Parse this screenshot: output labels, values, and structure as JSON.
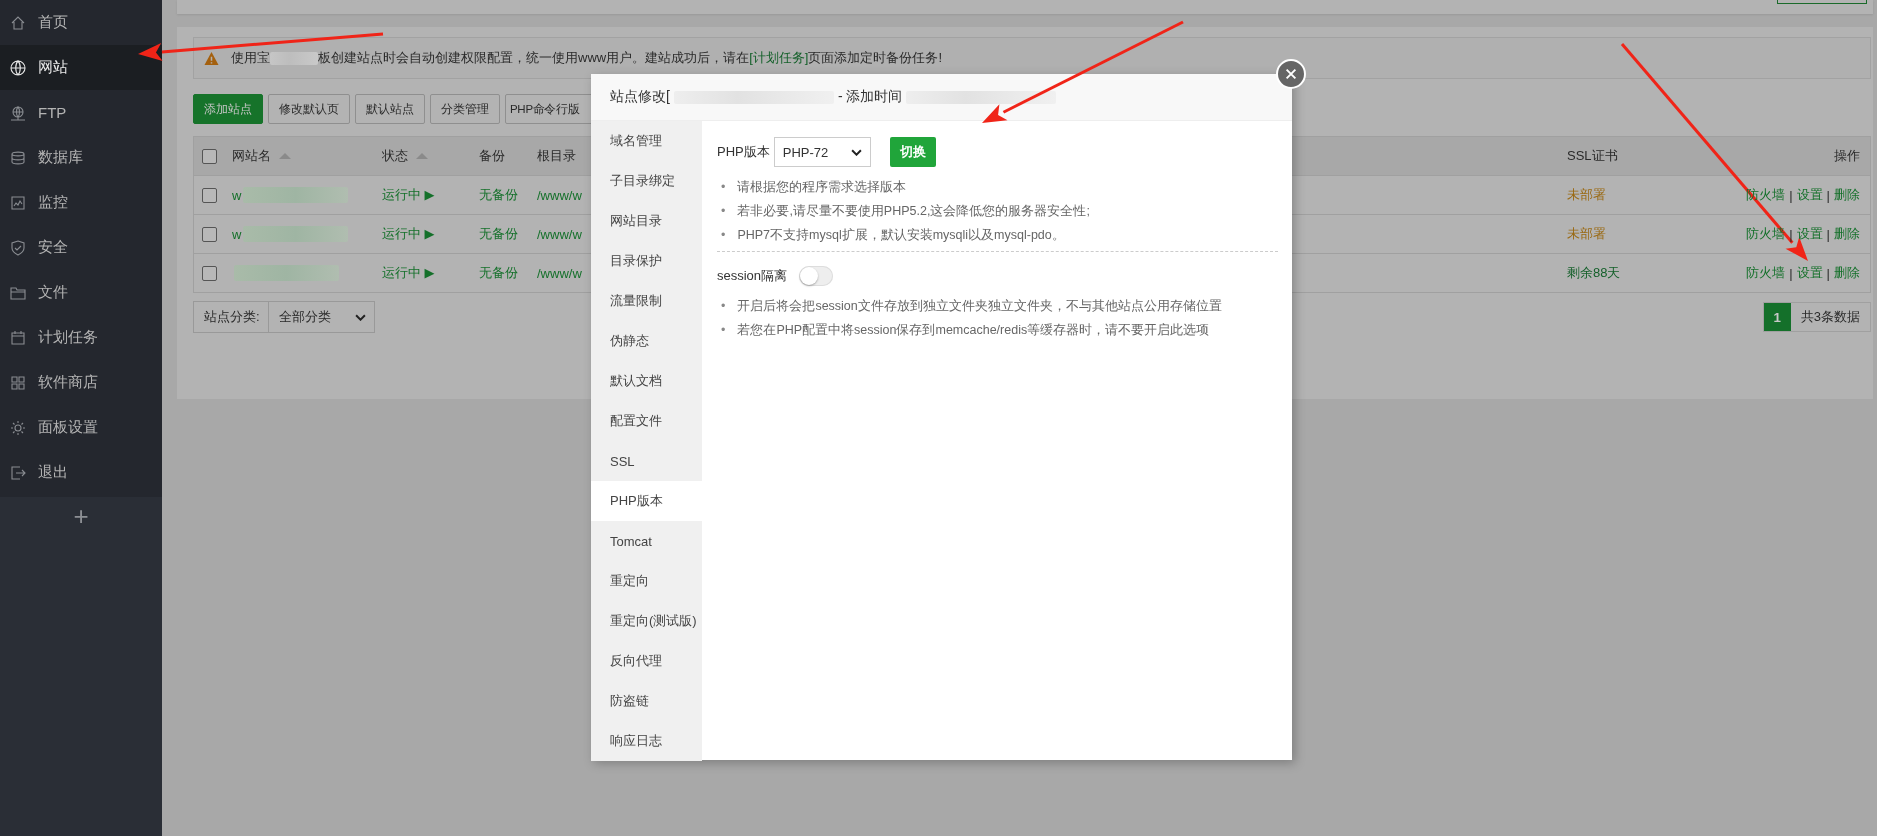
{
  "sidebar": {
    "items": [
      {
        "label": "首页",
        "selected": false
      },
      {
        "label": "网站",
        "selected": true
      },
      {
        "label": "FTP",
        "selected": false
      },
      {
        "label": "数据库",
        "selected": false
      },
      {
        "label": "监控",
        "selected": false
      },
      {
        "label": "安全",
        "selected": false
      },
      {
        "label": "文件",
        "selected": false
      },
      {
        "label": "计划任务",
        "selected": false
      },
      {
        "label": "软件商店",
        "selected": false
      },
      {
        "label": "面板设置",
        "selected": false
      },
      {
        "label": "退出",
        "selected": false
      }
    ],
    "add_button": "+"
  },
  "notice": {
    "head": "使用宝",
    "body": "板创建站点时会自动创建权限配置，统一使用www用户。建站成功后，请在",
    "link": "[计划任务]",
    "tail": "页面添加定时备份任务!"
  },
  "toolbar": {
    "buttons": [
      {
        "label": "添加站点",
        "kind": "primary"
      },
      {
        "label": "修改默认页",
        "kind": "default"
      },
      {
        "label": "默认站点",
        "kind": "default"
      },
      {
        "label": "分类管理",
        "kind": "default"
      },
      {
        "label": "PHP命令行版",
        "kind": "default"
      }
    ]
  },
  "table": {
    "header_checked": false,
    "columns": [
      {
        "label": "网站名",
        "sortable": true
      },
      {
        "label": "状态",
        "sortable": true
      },
      {
        "label": "备份",
        "sortable": false
      },
      {
        "label": "根目录",
        "sortable": false
      },
      {
        "label": "SSL证书",
        "sortable": false
      },
      {
        "label": "操作",
        "sortable": false
      }
    ],
    "rows": [
      {
        "checked": false,
        "name": "w",
        "status": "运行中 ▶",
        "backup": "无备份",
        "root": "/www/w",
        "ssl": "未部署",
        "color": "#9a6a14",
        "actions": [
          {
            "label": "防火墙",
            "kind": "link"
          },
          {
            "label": "|",
            "kind": "separator"
          },
          {
            "label": "设置",
            "kind": "link"
          },
          {
            "label": "|",
            "kind": "separator"
          },
          {
            "label": "删除",
            "kind": "link"
          }
        ]
      },
      {
        "checked": false,
        "name": "w",
        "status": "运行中 ▶",
        "backup": "无备份",
        "root": "/www/w",
        "ssl": "未部署",
        "color": "#9a6a14",
        "actions": [
          {
            "label": "防火墙",
            "kind": "link"
          },
          {
            "label": "|",
            "kind": "separator"
          },
          {
            "label": "设置",
            "kind": "link"
          },
          {
            "label": "|",
            "kind": "separator"
          },
          {
            "label": "删除",
            "kind": "link"
          }
        ]
      },
      {
        "checked": false,
        "status": "运行中 ▶",
        "backup": "无备份",
        "root": "/www/w",
        "ssl": "剩余88天",
        "color": "#14602a",
        "actions": [
          {
            "label": "防火墙",
            "kind": "link"
          },
          {
            "label": "|",
            "kind": "separator"
          },
          {
            "label": "设置",
            "kind": "link"
          },
          {
            "label": "|",
            "kind": "separator"
          },
          {
            "label": "删除",
            "kind": "link"
          }
        ]
      }
    ]
  },
  "footer": {
    "category_label": "站点分类:",
    "category_value": "全部分类",
    "pages": [
      {
        "label": "1",
        "selected": true
      }
    ],
    "total": "共3条数据"
  },
  "dialog": {
    "title": "站点修改[",
    "title_tail": "- 添加时间",
    "tabs": [
      {
        "label": "域名管理",
        "selected": false
      },
      {
        "label": "子目录绑定",
        "selected": false
      },
      {
        "label": "网站目录",
        "selected": false
      },
      {
        "label": "目录保护",
        "selected": false
      },
      {
        "label": "流量限制",
        "selected": false
      },
      {
        "label": "伪静态",
        "selected": false
      },
      {
        "label": "默认文档",
        "selected": false
      },
      {
        "label": "配置文件",
        "selected": false
      },
      {
        "label": "SSL",
        "selected": false
      },
      {
        "label": "PHP版本",
        "selected": true
      },
      {
        "label": "Tomcat",
        "selected": false
      },
      {
        "label": "重定向",
        "selected": false
      },
      {
        "label": "重定向(测试版)",
        "selected": false
      },
      {
        "label": "反向代理",
        "selected": false
      },
      {
        "label": "防盗链",
        "selected": false
      },
      {
        "label": "响应日志",
        "selected": false
      }
    ],
    "php_label": "PHP版本",
    "php_value": "PHP-72",
    "switch_button": "切换",
    "bullet": "•",
    "notes": [
      "请根据您的程序需求选择版本",
      "若非必要,请尽量不要使用PHP5.2,这会降低您的服务器安全性;",
      "PHP7不支持mysql扩展，默认安装mysqli以及mysql-pdo。"
    ],
    "session_label": "session隔离",
    "session_on": false,
    "session_notes": [
      "开启后将会把session文件存放到独立文件夹独立文件夹，不与其他站点公用存储位置",
      "若您在PHP配置中将session保存到memcache/redis等缓存器时，请不要开启此选项"
    ]
  }
}
